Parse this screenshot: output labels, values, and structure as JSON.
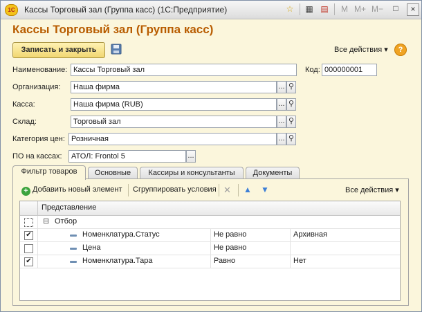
{
  "window": {
    "app_logo": "1С",
    "title": "Кассы Торговый зал (Группа касс)  (1С:Предприятие)",
    "toolbar_icons": [
      "favorites-star-icon",
      "calculator-icon",
      "calendar-icon",
      "restore-icon"
    ],
    "memory_buttons": [
      "M",
      "M+",
      "M−"
    ],
    "minimize": "_",
    "restore": "□",
    "close": "×"
  },
  "form": {
    "title": "Кассы Торговый зал (Группа касс)",
    "save_close_label": "Записать и закрыть",
    "all_actions_label": "Все действия ▾",
    "help_label": "?"
  },
  "fields": {
    "name": {
      "label": "Наименование:",
      "value": "Кассы Торговый зал"
    },
    "code": {
      "label": "Код:",
      "value": "000000001"
    },
    "organization": {
      "label": "Организация:",
      "value": "Наша фирма"
    },
    "cash_register": {
      "label": "Касса:",
      "value": "Наша фирма (RUB)"
    },
    "warehouse": {
      "label": "Склад:",
      "value": "Торговый зал"
    },
    "price_category": {
      "label": "Категория цен:",
      "value": "Розничная"
    },
    "pos_software": {
      "label": "ПО на кассах:",
      "value": "АТОЛ: Frontol 5"
    },
    "select_button": "...",
    "open_icon": "⚲"
  },
  "tabs": [
    {
      "label": "Фильтр товаров"
    },
    {
      "label": "Основные"
    },
    {
      "label": "Кассиры и консультанты"
    },
    {
      "label": "Документы"
    }
  ],
  "filter_panel": {
    "add_label": "Добавить новый элемент",
    "group_label": "Сгруппировать условия",
    "all_actions_label": "Все действия ▾",
    "column_header": "Представление",
    "root_label": "Отбор",
    "rows": [
      {
        "checked": true,
        "field": "Номенклатура.Статус",
        "condition": "Не равно",
        "value": "Архивная"
      },
      {
        "checked": false,
        "field": "Цена",
        "condition": "Не равно",
        "value": ""
      },
      {
        "checked": true,
        "field": "Номенклатура.Тара",
        "condition": "Равно",
        "value": "Нет"
      }
    ]
  },
  "colors": {
    "form_background": "#fbf6dc",
    "title_color": "#b85c00",
    "primary_button": "#f1d772",
    "accent_arrow": "#3d7fd6",
    "add_icon": "#3ca33c",
    "help_icon": "#f0a424"
  }
}
